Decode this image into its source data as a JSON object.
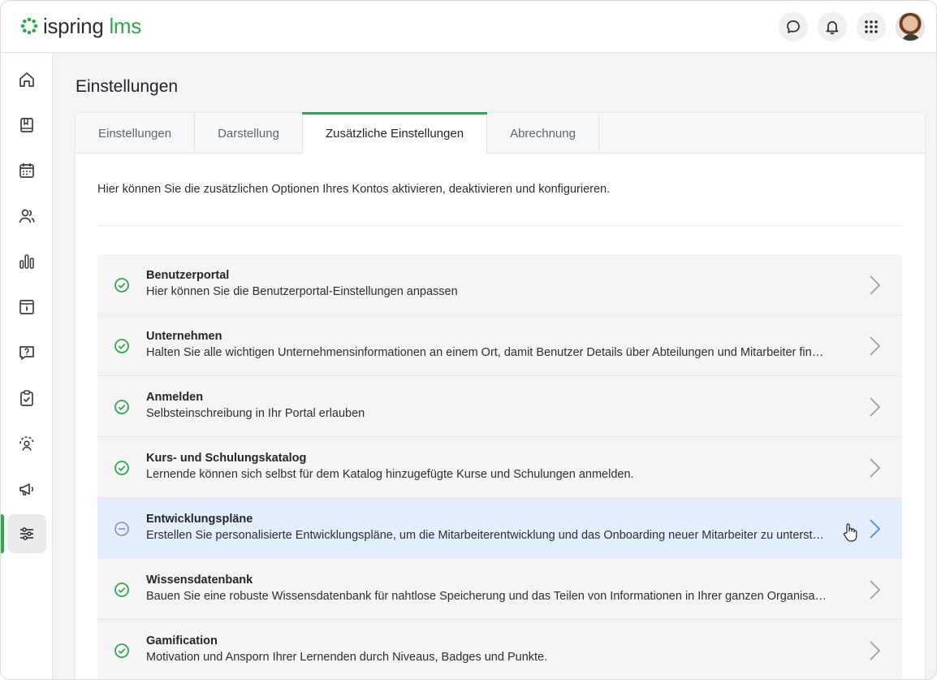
{
  "app": {
    "logo_part1": "ispring",
    "logo_part2": "lms",
    "brand_color": "#2fa84f"
  },
  "header": {
    "icons": [
      "chat-icon",
      "bell-icon",
      "apps-grid-icon"
    ],
    "avatar": "user-avatar"
  },
  "sidebar": {
    "items": [
      {
        "icon": "home-icon"
      },
      {
        "icon": "book-icon"
      },
      {
        "icon": "calendar-icon"
      },
      {
        "icon": "users-icon"
      },
      {
        "icon": "bar-chart-icon"
      },
      {
        "icon": "info-archive-icon"
      },
      {
        "icon": "question-chat-icon"
      },
      {
        "icon": "clipboard-check-icon"
      },
      {
        "icon": "user-feedback-icon"
      },
      {
        "icon": "megaphone-icon"
      },
      {
        "icon": "sliders-icon",
        "active": true
      }
    ]
  },
  "page": {
    "title": "Einstellungen"
  },
  "tabs": [
    {
      "label": "Einstellungen"
    },
    {
      "label": "Darstellung"
    },
    {
      "label": "Zusätzliche Einstellungen",
      "active": true
    },
    {
      "label": "Abrechnung"
    }
  ],
  "intro": "Hier können Sie die zusätzlichen Optionen Ihres Kontos aktivieren, deaktivieren und konfigurieren.",
  "options": [
    {
      "title": "Benutzerportal",
      "desc": "Hier können Sie die Benutzerportal-Einstellungen anpassen",
      "enabled": true
    },
    {
      "title": "Unternehmen",
      "desc": "Halten Sie alle wichtigen Unternehmensinformationen an einem Ort, damit Benutzer Details über Abteilungen und Mitarbeiter finden können.",
      "enabled": true
    },
    {
      "title": "Anmelden",
      "desc": "Selbsteinschreibung in Ihr Portal erlauben",
      "enabled": true
    },
    {
      "title": "Kurs- und Schulungskatalog",
      "desc": "Lernende können sich selbst für dem Katalog hinzugefügte Kurse und Schulungen anmelden.",
      "enabled": true
    },
    {
      "title": "Entwicklungspläne",
      "desc": "Erstellen Sie personalisierte Entwicklungspläne, um die Mitarbeiterentwicklung und das Onboarding neuer Mitarbeiter zu unterstützen.",
      "enabled": false,
      "hovered": true
    },
    {
      "title": "Wissensdatenbank",
      "desc": "Bauen Sie eine robuste Wissensdatenbank für nahtlose Speicherung und das Teilen von Informationen in Ihrer ganzen Organisation.",
      "enabled": true
    },
    {
      "title": "Gamification",
      "desc": "Motivation und Ansporn Ihrer Lernenden durch Niveaus, Badges und Punkte.",
      "enabled": true
    }
  ],
  "colors": {
    "enabled": "#2fa84f",
    "disabled": "#8a9097",
    "highlight_row": "#e3eefa",
    "chevron": "#9aa0a6",
    "chevron_active": "#4a8fd6"
  }
}
